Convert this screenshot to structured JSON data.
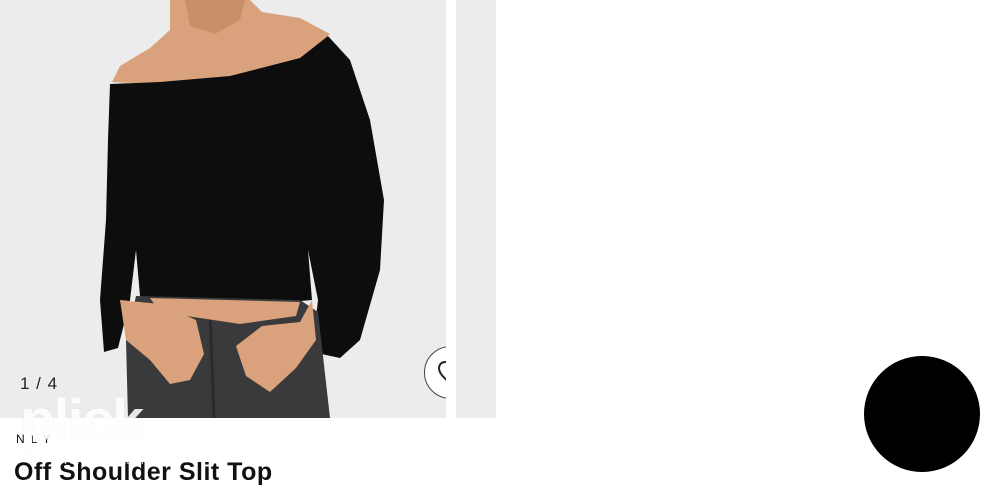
{
  "gallery": {
    "counter": "1 / 4"
  },
  "product": {
    "brand": "NLY",
    "title": "Off Shoulder Slit Top"
  },
  "watermark": {
    "logo": "plick",
    "tagline": "reloved fashion"
  },
  "colors": {
    "photo_background": "#ececec",
    "garment": "#0d0d0d",
    "skin": "#d9a27c",
    "denim": "#3a3a3c",
    "floating_button": "#000000"
  },
  "icons": {
    "favorite": "heart-outline-icon"
  }
}
